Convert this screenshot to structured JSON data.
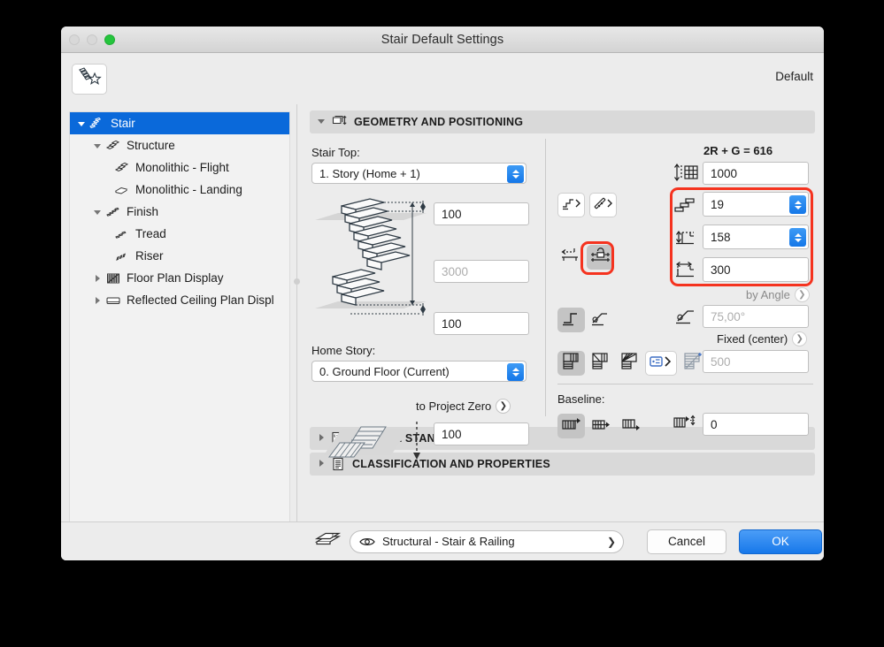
{
  "window": {
    "title": "Stair Default Settings",
    "traffic_lights": [
      "close-button",
      "minimize-button",
      "zoom-button"
    ],
    "favorites_icon": "stair-favorite-icon",
    "default_label": "Default"
  },
  "sidebar": {
    "items": [
      {
        "label": "Stair",
        "depth": 0,
        "icon": "stair-icon",
        "twisty": "down",
        "selected": true
      },
      {
        "label": "Structure",
        "depth": 1,
        "icon": "structure-icon",
        "twisty": "down",
        "selected": false
      },
      {
        "label": "Monolithic - Flight",
        "depth": 2,
        "icon": "monolithic-flight-icon",
        "twisty": "none",
        "selected": false
      },
      {
        "label": "Monolithic - Landing",
        "depth": 2,
        "icon": "monolithic-landing-icon",
        "twisty": "none",
        "selected": false
      },
      {
        "label": "Finish",
        "depth": 1,
        "icon": "finish-icon",
        "twisty": "down",
        "selected": false
      },
      {
        "label": "Tread",
        "depth": 2,
        "icon": "tread-icon",
        "twisty": "none",
        "selected": false
      },
      {
        "label": "Riser",
        "depth": 2,
        "icon": "riser-icon",
        "twisty": "none",
        "selected": false
      },
      {
        "label": "Floor Plan Display",
        "depth": 1,
        "icon": "floor-plan-display-icon",
        "twisty": "right",
        "selected": false
      },
      {
        "label": "Reflected Ceiling Plan Displ",
        "depth": 1,
        "icon": "reflected-ceiling-plan-icon",
        "twisty": "right",
        "selected": false
      }
    ],
    "scrollbar": "horizontal-scrollbar"
  },
  "main": {
    "sections": [
      {
        "key": "geometry",
        "title": "GEOMETRY AND POSITIONING",
        "icon": "geometry-positioning-icon",
        "expanded": true
      },
      {
        "key": "rules",
        "title": "RULES & STANDARDS",
        "icon": "rules-standards-icon",
        "expanded": false
      },
      {
        "key": "classification",
        "title": "CLASSIFICATION AND PROPERTIES",
        "icon": "classification-properties-icon",
        "expanded": false
      }
    ],
    "geometry": {
      "stair_top_label": "Stair Top:",
      "stair_top_value": "1. Story (Home + 1)",
      "home_story_label": "Home Story:",
      "home_story_value": "0. Ground Floor (Current)",
      "top_offset_value": "100",
      "total_height_value": "3000",
      "total_height_enabled": false,
      "bottom_offset_value": "100",
      "to_project_zero_label": "to Project Zero",
      "to_project_zero_value": "100",
      "project_zero_icon": "stair-plan-projection-icon",
      "formula_label": "2R + G = 616",
      "height_icon": "total-height-icon",
      "height_value": "1000",
      "risers_icon": "number-of-risers-icon",
      "risers_value": "19",
      "riser_height_icon": "riser-height-icon",
      "riser_height_value": "158",
      "tread_depth_icon": "tread-depth-icon",
      "tread_depth_value": "300",
      "by_angle_label": "by Angle",
      "angle_icon": "stair-angle-icon",
      "angle_value": "75,00°",
      "angle_enabled": false,
      "fixed_center_label": "Fixed (center)",
      "walking_line_value": "500",
      "walking_line_enabled": false,
      "flight_buttons": [
        {
          "icon": "straight-flight-icon",
          "name": "flight-edit-button"
        },
        {
          "icon": "curved-flight-icon",
          "name": "turn-edit-button"
        }
      ],
      "width_buttons": [
        {
          "icon": "width-free-icon",
          "name": "width-free-button",
          "active": false
        },
        {
          "icon": "width-locked-icon",
          "name": "width-locked-button",
          "active": true
        }
      ],
      "angle_buttons": [
        {
          "icon": "riser-shape-straight-icon",
          "name": "riser-straight-button",
          "active": true
        },
        {
          "icon": "riser-shape-angled-icon",
          "name": "riser-angled-button",
          "active": false
        }
      ],
      "winder_buttons": [
        {
          "icon": "winder-none-icon",
          "name": "winder-none-button",
          "active": true
        },
        {
          "icon": "winder-balanced-icon",
          "name": "winder-balanced-button",
          "active": false
        },
        {
          "icon": "winder-radial-icon",
          "name": "winder-radial-button",
          "active": false
        },
        {
          "icon": "winder-settings-icon",
          "name": "winder-settings-button",
          "active": false
        },
        {
          "icon": "winder-custom-icon",
          "name": "winder-custom-button",
          "active": false
        }
      ],
      "baseline_label": "Baseline:",
      "baseline_buttons": [
        {
          "icon": "baseline-left-icon",
          "name": "baseline-left-button",
          "active": true
        },
        {
          "icon": "baseline-center-icon",
          "name": "baseline-center-button",
          "active": false
        },
        {
          "icon": "baseline-right-icon",
          "name": "baseline-right-button",
          "active": false
        }
      ],
      "baseline_offset_icon": "baseline-offset-icon",
      "baseline_offset_value": "0"
    },
    "highlight_color": "#f5331f"
  },
  "bottombar": {
    "layers_icon": "layers-icon",
    "eye_icon": "eye-icon",
    "layer_value": "Structural - Stair & Railing",
    "cancel_label": "Cancel",
    "ok_label": "OK",
    "ok_color": "#1778ea"
  }
}
